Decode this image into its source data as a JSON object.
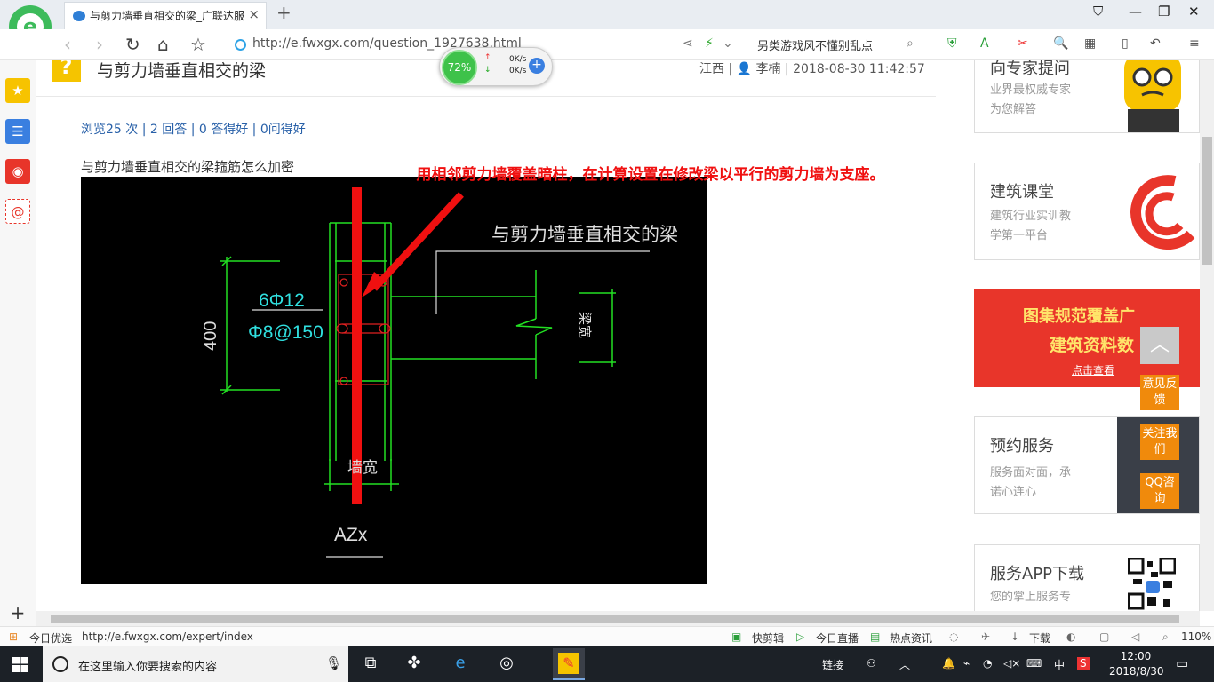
{
  "browser": {
    "tab_title": "与剪力墙垂直相交的梁_广联达服",
    "new_tab": "+",
    "window_controls": [
      "⛉",
      "—",
      "❐",
      "✕"
    ],
    "url": "http://e.fwxgx.com/question_1927638.html",
    "search_hint": "另类游戏风不懂别乱点",
    "speed": {
      "percent": "72%",
      "up": "0K/s",
      "down": "0K/s"
    }
  },
  "question": {
    "title": "与剪力墙垂直相交的梁",
    "meta": "江西 | 👤 李楠 | 2018-08-30 11:42:57",
    "stats": "浏览25 次 | 2 回答 | 0 答得好 | 0问得好",
    "text": "与剪力墙垂直相交的梁箍筋怎么加密",
    "annotation": "用相邻剪力墙覆盖暗柱，在计算设置在修改梁以平行的剪力墙为支座。",
    "cad": {
      "beam_label": "与剪力墙垂直相交的梁",
      "rebar_main": "6Φ12",
      "rebar_stirrup": "Φ8@150",
      "dim_height": "400",
      "dim_beam_width": "梁宽",
      "dim_wall": "墙宽",
      "column_tag": "AZx"
    }
  },
  "right_panel": {
    "ask_expert": {
      "title": "向专家提问",
      "sub1": "业界最权威专家",
      "sub2": "为您解答"
    },
    "course": {
      "title": "建筑课堂",
      "sub1": "建筑行业实训教",
      "sub2": "学第一平台"
    },
    "banner": {
      "line1": "图集规范覆盖广",
      "line2": "建筑资料数",
      "cta": "点击查看"
    },
    "booking": {
      "title": "预约服务",
      "sub1": "服务面对面，承",
      "sub2": "诺心连心"
    },
    "app": {
      "title": "服务APP下载",
      "sub1": "您的掌上服务专"
    }
  },
  "float_buttons": {
    "feedback": "意见反馈",
    "follow": "关注我们",
    "qq": "QQ咨询"
  },
  "statusbar": {
    "today": "今日优选",
    "link": "http://e.fwxgx.com/expert/index",
    "quick_cut": "快剪辑",
    "live": "今日直播",
    "news": "热点资讯",
    "download": "下载",
    "zoom": "110%"
  },
  "taskbar": {
    "search_placeholder": "在这里输入你要搜索的内容",
    "links": "链接",
    "ime": "中",
    "time": "12:00",
    "date": "2018/8/30"
  },
  "colors": {
    "accent_red": "#f01010",
    "cad_green": "#22e022",
    "cad_cyan": "#30e0e0",
    "float_orange": "#f08a0c"
  }
}
